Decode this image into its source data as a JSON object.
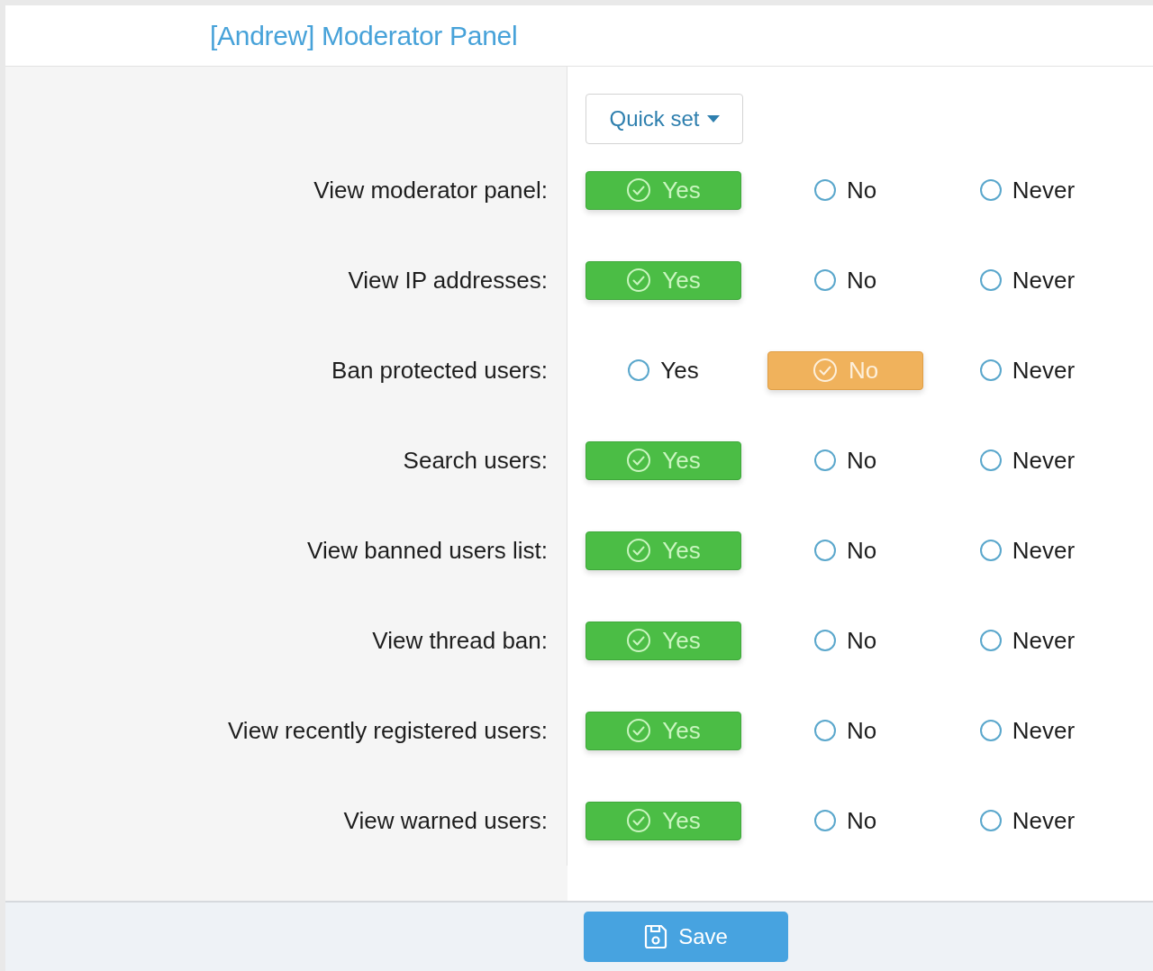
{
  "header": {
    "title": "[Andrew] Moderator Panel"
  },
  "quick_set": {
    "label": "Quick set"
  },
  "permissions": [
    {
      "label": "View moderator panel:",
      "options": [
        {
          "kind": "yes",
          "label": "Yes",
          "selected": true
        },
        {
          "kind": "no",
          "label": "No",
          "selected": false
        },
        {
          "kind": "never",
          "label": "Never",
          "selected": false
        }
      ]
    },
    {
      "label": "View IP addresses:",
      "options": [
        {
          "kind": "yes",
          "label": "Yes",
          "selected": true
        },
        {
          "kind": "no",
          "label": "No",
          "selected": false
        },
        {
          "kind": "never",
          "label": "Never",
          "selected": false
        }
      ]
    },
    {
      "label": "Ban protected users:",
      "options": [
        {
          "kind": "yes",
          "label": "Yes",
          "selected": false
        },
        {
          "kind": "no",
          "label": "No",
          "selected": true
        },
        {
          "kind": "never",
          "label": "Never",
          "selected": false
        }
      ]
    },
    {
      "label": "Search users:",
      "options": [
        {
          "kind": "yes",
          "label": "Yes",
          "selected": true
        },
        {
          "kind": "no",
          "label": "No",
          "selected": false
        },
        {
          "kind": "never",
          "label": "Never",
          "selected": false
        }
      ]
    },
    {
      "label": "View banned users list:",
      "options": [
        {
          "kind": "yes",
          "label": "Yes",
          "selected": true
        },
        {
          "kind": "no",
          "label": "No",
          "selected": false
        },
        {
          "kind": "never",
          "label": "Never",
          "selected": false
        }
      ]
    },
    {
      "label": "View thread ban:",
      "options": [
        {
          "kind": "yes",
          "label": "Yes",
          "selected": true
        },
        {
          "kind": "no",
          "label": "No",
          "selected": false
        },
        {
          "kind": "never",
          "label": "Never",
          "selected": false
        }
      ]
    },
    {
      "label": "View recently registered users:",
      "options": [
        {
          "kind": "yes",
          "label": "Yes",
          "selected": true
        },
        {
          "kind": "no",
          "label": "No",
          "selected": false
        },
        {
          "kind": "never",
          "label": "Never",
          "selected": false
        }
      ]
    },
    {
      "label": "View warned users:",
      "options": [
        {
          "kind": "yes",
          "label": "Yes",
          "selected": true
        },
        {
          "kind": "no",
          "label": "No",
          "selected": false
        },
        {
          "kind": "never",
          "label": "Never",
          "selected": false
        }
      ]
    }
  ],
  "save_button": {
    "label": "Save"
  }
}
